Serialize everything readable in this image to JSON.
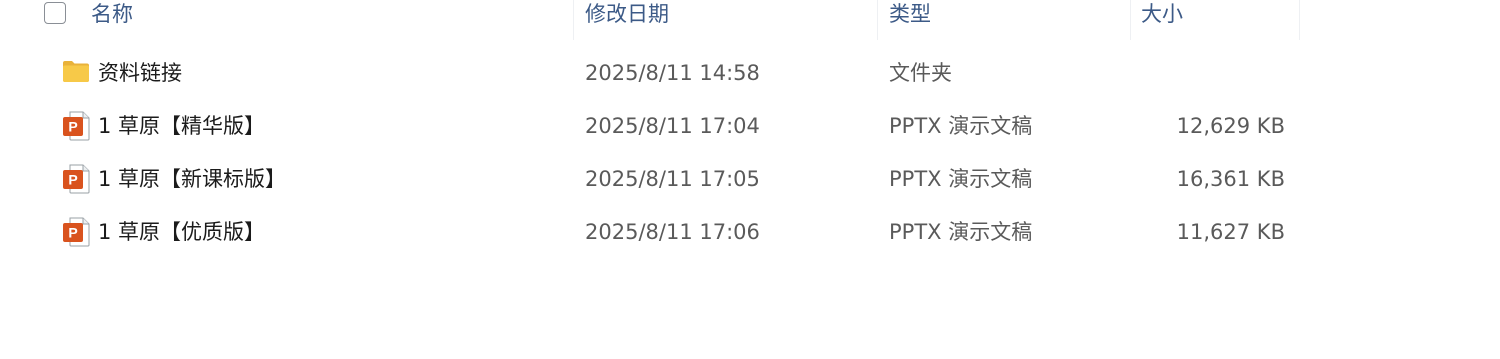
{
  "header": {
    "name_label": "名称",
    "date_label": "修改日期",
    "type_label": "类型",
    "size_label": "大小"
  },
  "files": [
    {
      "icon": "folder-icon",
      "name": "资料链接",
      "modified": "2025/8/11 14:58",
      "type": "文件夹",
      "size": ""
    },
    {
      "icon": "pptx-icon",
      "name": "1 草原【精华版】",
      "modified": "2025/8/11 17:04",
      "type": "PPTX 演示文稿",
      "size": "12,629 KB"
    },
    {
      "icon": "pptx-icon",
      "name": "1 草原【新课标版】",
      "modified": "2025/8/11 17:05",
      "type": "PPTX 演示文稿",
      "size": "16,361 KB"
    },
    {
      "icon": "pptx-icon",
      "name": "1 草原【优质版】",
      "modified": "2025/8/11 17:06",
      "type": "PPTX 演示文稿",
      "size": "11,627 KB"
    }
  ],
  "colors": {
    "header_text": "#3c5a87",
    "folder": "#f7c948",
    "pptx": "#d9531e"
  }
}
